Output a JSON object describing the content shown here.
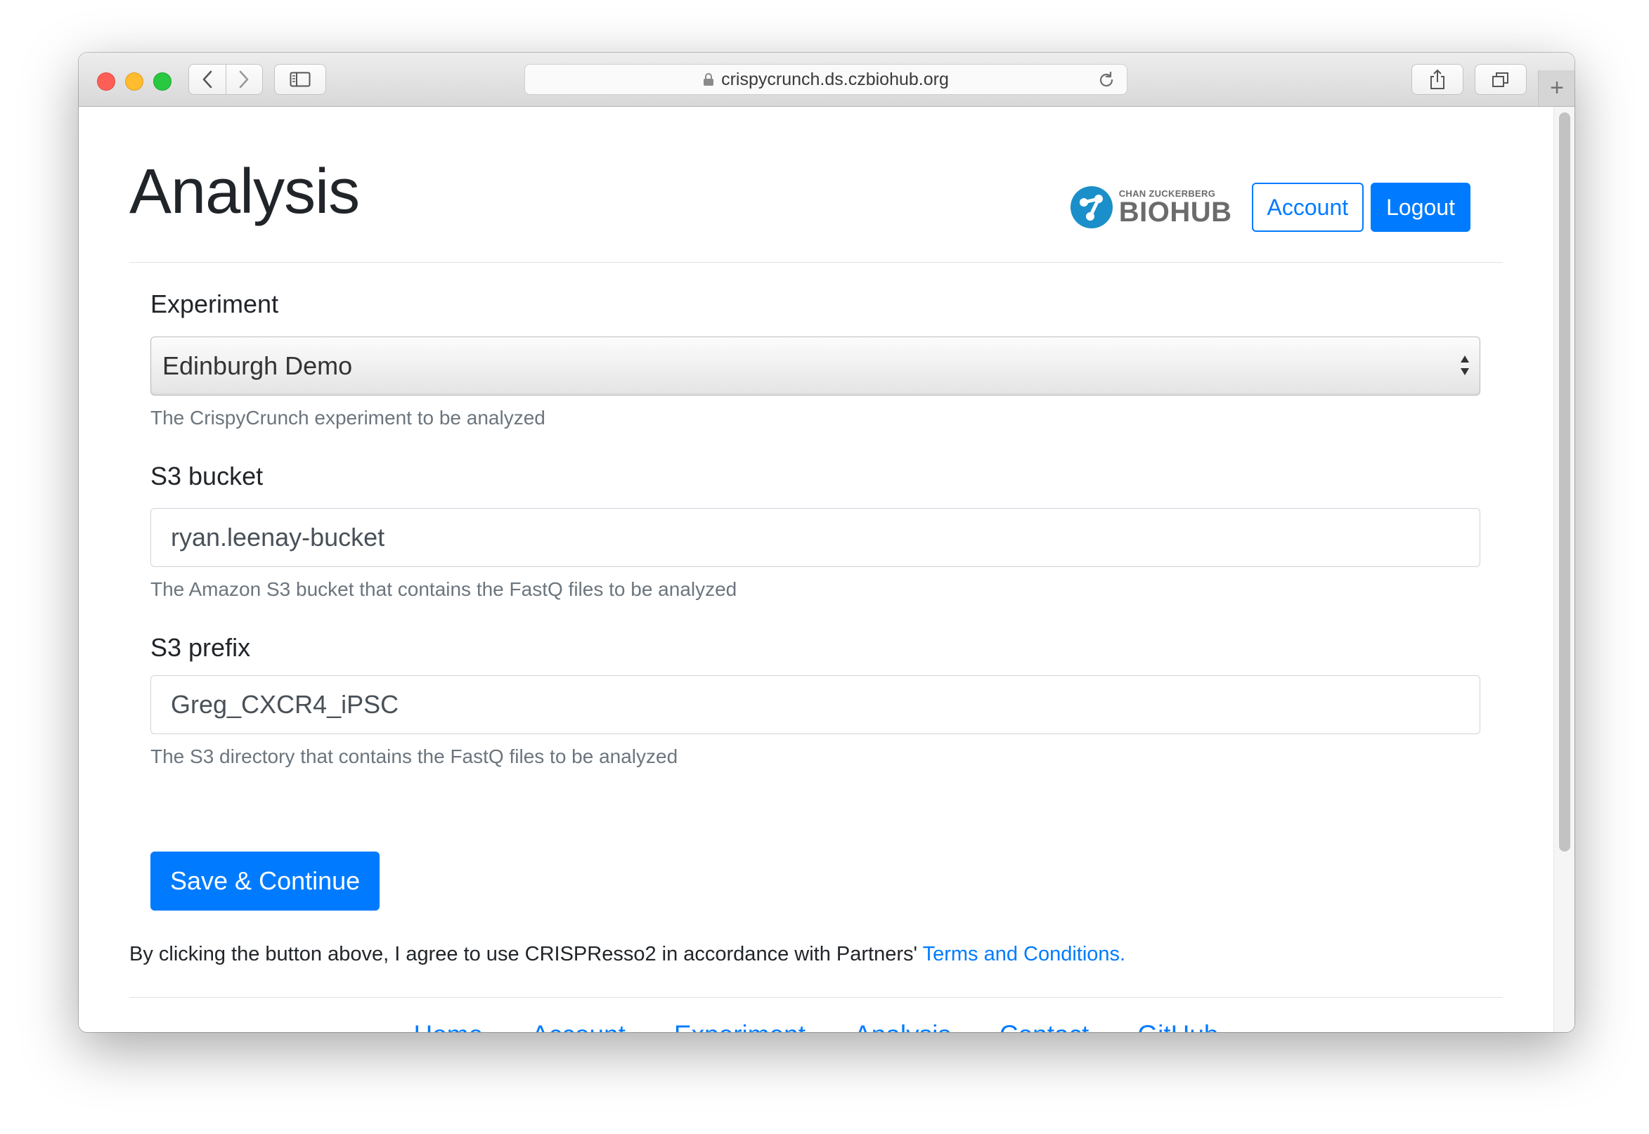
{
  "browser": {
    "url": "crispycrunch.ds.czbiohub.org"
  },
  "header": {
    "title": "Analysis",
    "logo_small": "CHAN ZUCKERBERG",
    "logo_big": "BIOHUB",
    "account_label": "Account",
    "logout_label": "Logout"
  },
  "form": {
    "experiment": {
      "label": "Experiment",
      "value": "Edinburgh Demo",
      "help": "The CrispyCrunch experiment to be analyzed"
    },
    "bucket": {
      "label": "S3 bucket",
      "value": "ryan.leenay-bucket",
      "help": "The Amazon S3 bucket that contains the FastQ files to be analyzed"
    },
    "prefix": {
      "label": "S3 prefix",
      "value": "Greg_CXCR4_iPSC",
      "help": "The S3 directory that contains the FastQ files to be analyzed"
    },
    "submit_label": "Save & Continue"
  },
  "agreement": {
    "text": "By clicking the button above, I agree to use CRISPResso2 in accordance with Partners' ",
    "link_text": "Terms and Conditions."
  },
  "footer": {
    "links": [
      "Home",
      "Account",
      "Experiment",
      "Analysis",
      "Contact",
      "GitHub"
    ]
  },
  "colors": {
    "primary": "#007bff",
    "text": "#212529",
    "muted": "#6c757d",
    "logo_blue": "#1a8fc9"
  }
}
